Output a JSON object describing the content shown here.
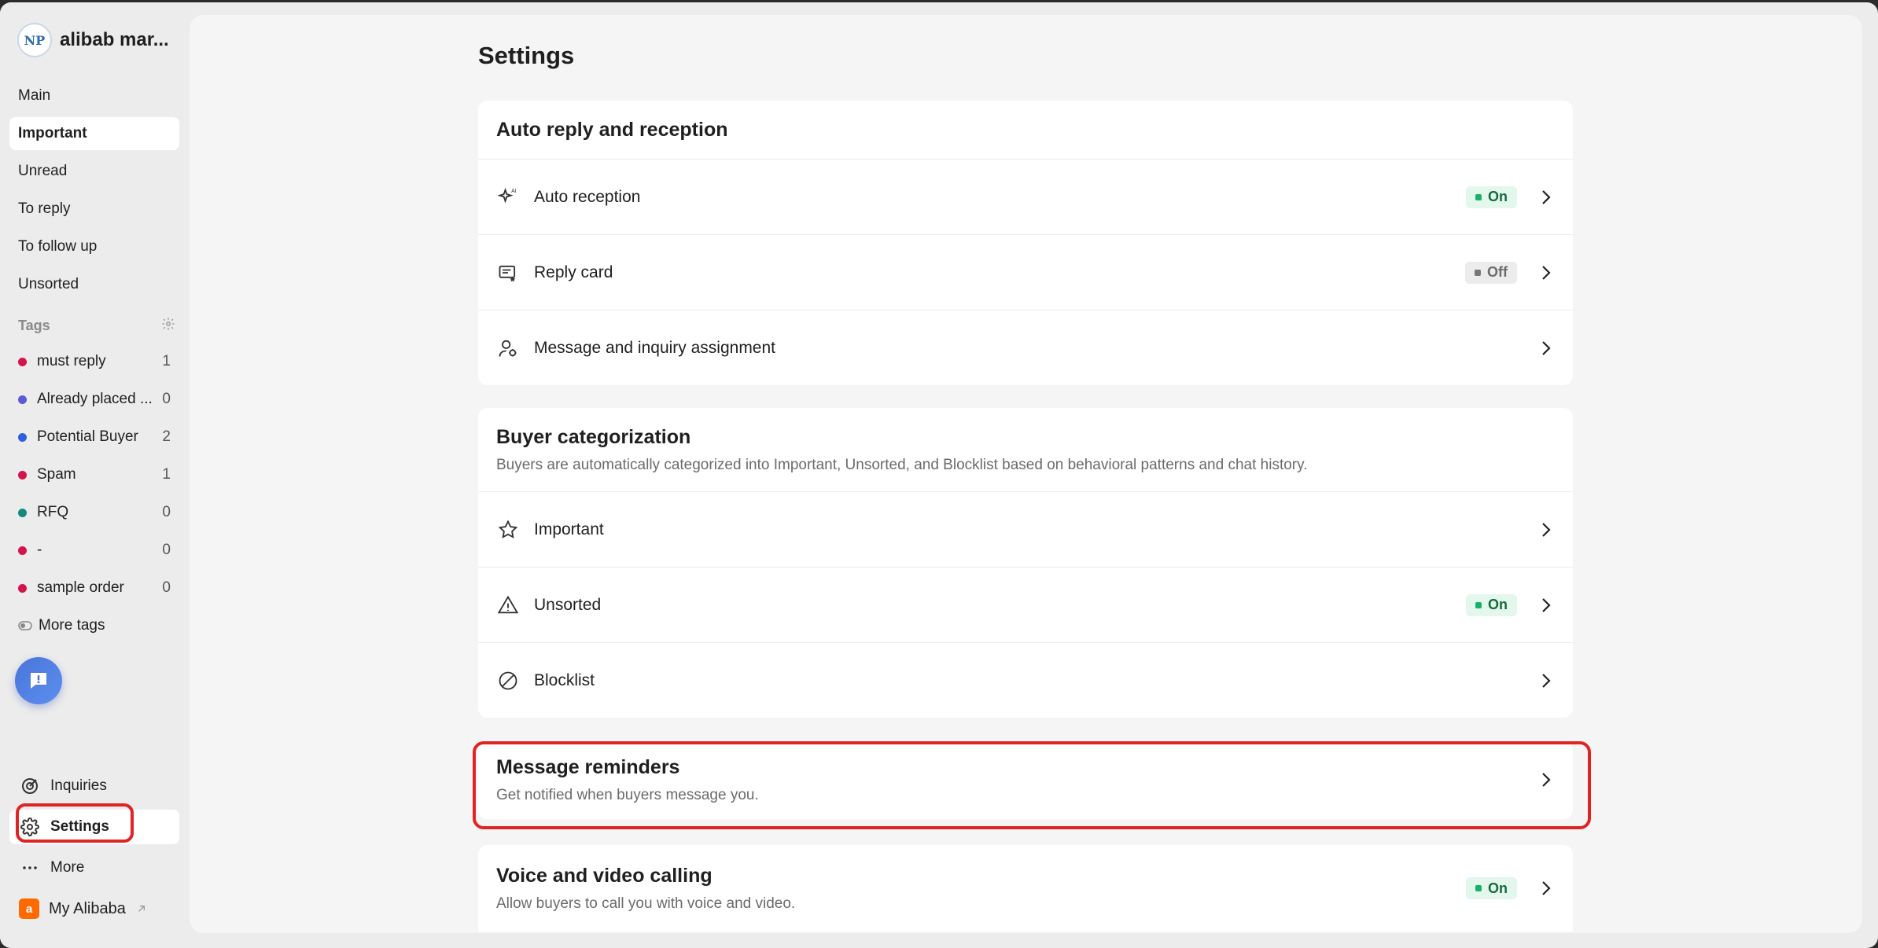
{
  "sidebar": {
    "brand_name": "alibab mar...",
    "brand_logo_text": "NP",
    "nav": [
      "Main",
      "Important",
      "Unread",
      "To reply",
      "To follow up",
      "Unsorted"
    ],
    "tags_heading": "Tags",
    "tags": [
      {
        "name": "must reply",
        "count": "1",
        "color": "#d4144a"
      },
      {
        "name": "Already placed ...",
        "count": "0",
        "color": "#5b5bd6"
      },
      {
        "name": "Potential Buyer",
        "count": "2",
        "color": "#2f5fe0"
      },
      {
        "name": "Spam",
        "count": "1",
        "color": "#d4144a"
      },
      {
        "name": "RFQ",
        "count": "0",
        "color": "#138a7e"
      },
      {
        "name": "-",
        "count": "0",
        "color": "#d4144a"
      },
      {
        "name": "sample order",
        "count": "0",
        "color": "#d4144a"
      }
    ],
    "more_tags": "More tags",
    "bottom": {
      "inquiries": "Inquiries",
      "settings": "Settings",
      "more": "More",
      "my_alibaba": "My Alibaba"
    }
  },
  "main": {
    "title": "Settings",
    "auto_reply": {
      "title": "Auto reply and reception",
      "rows": [
        {
          "label": "Auto reception",
          "badge": "On",
          "icon": "ai-sparkle-icon"
        },
        {
          "label": "Reply card",
          "badge": "Off",
          "icon": "reply-card-icon"
        },
        {
          "label": "Message and inquiry assignment",
          "badge": "",
          "icon": "user-assign-icon"
        }
      ]
    },
    "buyer_cat": {
      "title": "Buyer categorization",
      "subtitle": "Buyers are automatically categorized into Important, Unsorted, and Blocklist based on behavioral patterns and chat history.",
      "rows": [
        {
          "label": "Important",
          "badge": "",
          "icon": "star-icon"
        },
        {
          "label": "Unsorted",
          "badge": "On",
          "icon": "warning-icon"
        },
        {
          "label": "Blocklist",
          "badge": "",
          "icon": "block-icon"
        }
      ]
    },
    "reminders": {
      "title": "Message reminders",
      "subtitle": "Get notified when buyers message you."
    },
    "calling": {
      "title": "Voice and video calling",
      "subtitle": "Allow buyers to call you with voice and video.",
      "badge": "On"
    }
  },
  "colors": {
    "accent_red": "#e02424",
    "on_green": "#17b26a"
  }
}
